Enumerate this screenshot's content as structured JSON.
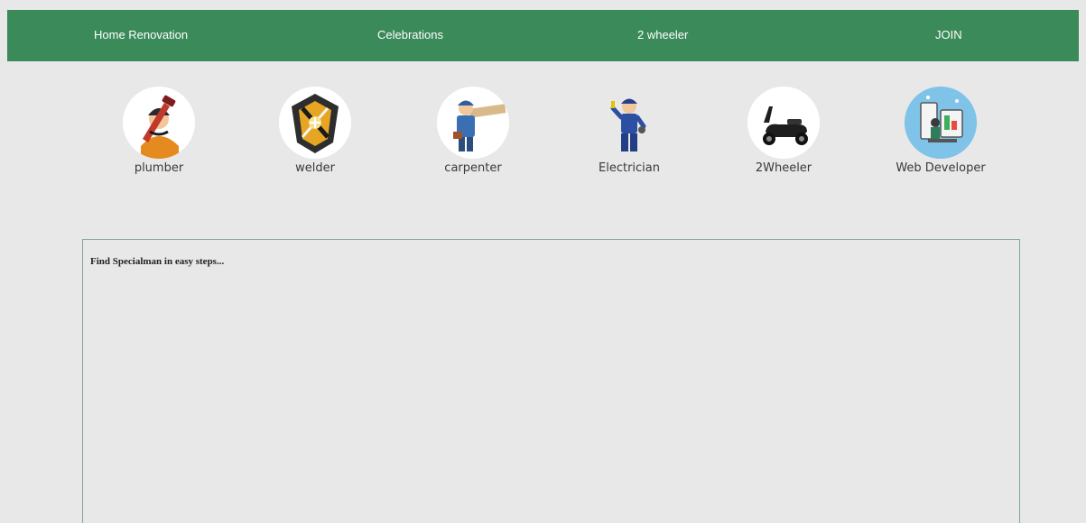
{
  "nav": {
    "items": [
      {
        "label": "Home Renovation"
      },
      {
        "label": "Celebrations"
      },
      {
        "label": "2 wheeler"
      },
      {
        "label": "JOIN"
      }
    ],
    "background": "#3b8a5a"
  },
  "categories": [
    {
      "label": "plumber",
      "icon": "plumber-icon"
    },
    {
      "label": "welder",
      "icon": "welder-icon"
    },
    {
      "label": "carpenter",
      "icon": "carpenter-icon"
    },
    {
      "label": "Electrician",
      "icon": "electrician-icon"
    },
    {
      "label": "2Wheeler",
      "icon": "scooter-icon"
    },
    {
      "label": "Web Developer",
      "icon": "web-developer-icon"
    }
  ],
  "panel": {
    "title": "Find Specialman in easy steps..."
  }
}
